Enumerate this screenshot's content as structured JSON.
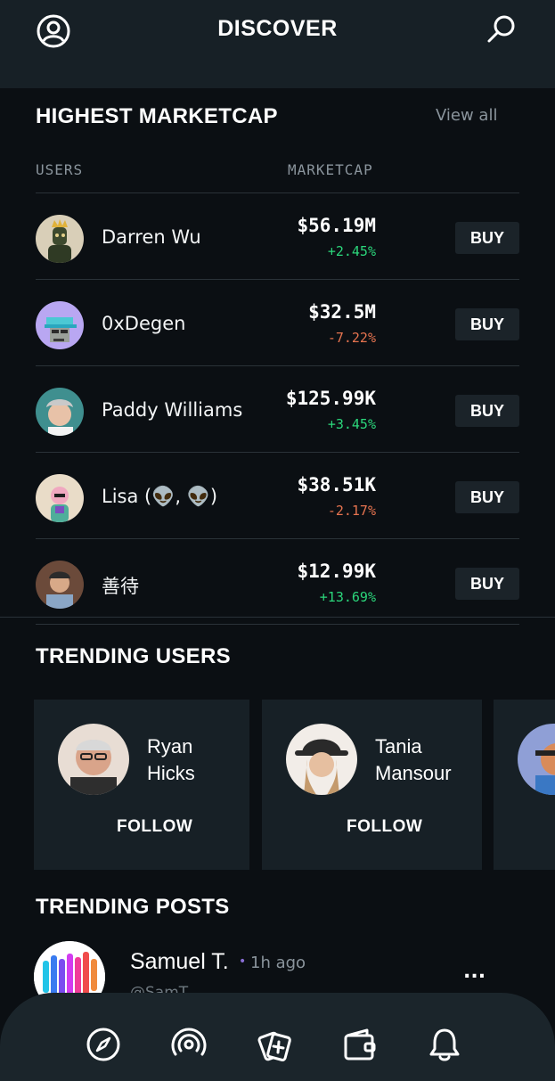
{
  "header": {
    "title": "DISCOVER",
    "profile_icon": "user-circle-icon",
    "search_icon": "search-icon"
  },
  "marketcap": {
    "title": "HIGHEST MARKETCAP",
    "view_all": "View all",
    "col_users": "USERS",
    "col_marketcap": "MARKETCAP",
    "rows": [
      {
        "name": "Darren Wu",
        "cap": "$56.19M",
        "change": "+2.45%",
        "direction": "up",
        "buy": "BUY"
      },
      {
        "name": "0xDegen",
        "cap": "$32.5M",
        "change": "-7.22%",
        "direction": "down",
        "buy": "BUY"
      },
      {
        "name": "Paddy Williams",
        "cap": "$125.99K",
        "change": "+3.45%",
        "direction": "up",
        "buy": "BUY"
      },
      {
        "name": "Lisa (👽, 👽)",
        "cap": "$38.51K",
        "change": "-2.17%",
        "direction": "down",
        "buy": "BUY"
      },
      {
        "name": "善待",
        "cap": "$12.99K",
        "change": "+13.69%",
        "direction": "up",
        "buy": "BUY"
      }
    ]
  },
  "trending_users": {
    "title": "TRENDING USERS",
    "cards": [
      {
        "name_line1": "Ryan",
        "name_line2": "Hicks",
        "follow": "FOLLOW"
      },
      {
        "name_line1": "Tania",
        "name_line2": "Mansour",
        "follow": "FOLLOW"
      }
    ]
  },
  "trending_posts": {
    "title": "TRENDING POSTS",
    "post": {
      "name": "Samuel T.",
      "dot": "•",
      "time": "1h ago",
      "handle": "@SamT",
      "more": "..."
    }
  },
  "tabbar": {
    "icons": [
      "compass-icon",
      "broadcast-icon",
      "cards-add-icon",
      "wallet-icon",
      "bell-icon"
    ]
  },
  "colors": {
    "background": "#0b0f13",
    "panel": "#172026",
    "positive": "#2bd67b",
    "negative": "#e5734f"
  }
}
